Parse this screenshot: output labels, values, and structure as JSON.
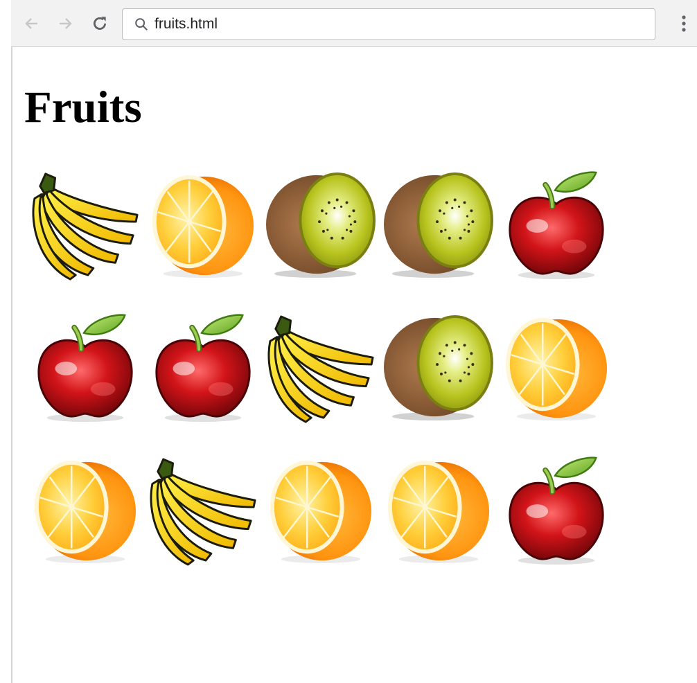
{
  "browser": {
    "url": "fruits.html",
    "icons": {
      "back": "back-arrow-icon",
      "forward": "forward-arrow-icon",
      "reload": "reload-icon",
      "search": "search-icon",
      "menu": "kebab-menu-icon"
    }
  },
  "page": {
    "heading": "Fruits",
    "grid": [
      [
        "banana",
        "orange",
        "kiwi",
        "kiwi",
        "apple"
      ],
      [
        "apple",
        "apple",
        "banana",
        "kiwi",
        "orange"
      ],
      [
        "orange",
        "banana",
        "orange",
        "orange",
        "apple"
      ]
    ]
  },
  "colors": {
    "banana": "#f7d117",
    "orange": "#ff9f10",
    "kiwi": "#b6c21b",
    "apple": "#c0161a"
  }
}
